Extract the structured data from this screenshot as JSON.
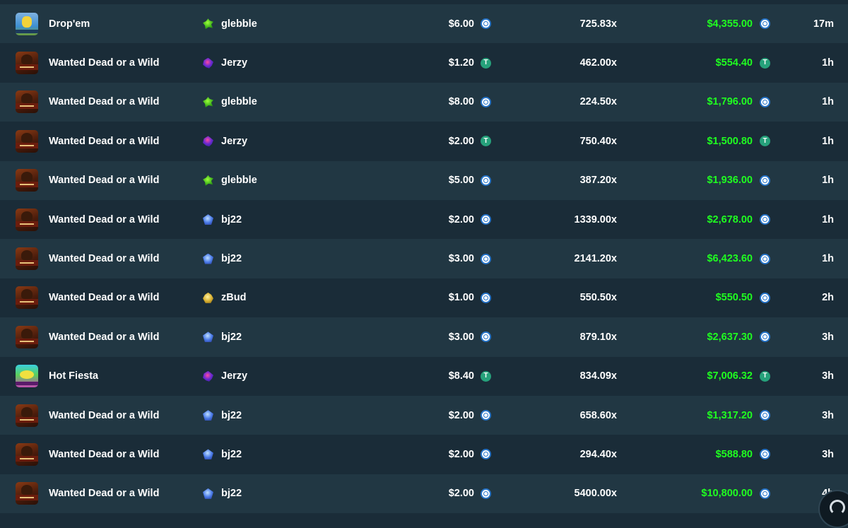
{
  "rows": [
    {
      "game": "Drop'em",
      "thumb": "dropem",
      "user": "glebble",
      "user_icon": "green",
      "bet": "$6.00",
      "bet_coin": "usdc",
      "multiplier": "725.83x",
      "payout": "$4,355.00",
      "payout_coin": "usdc",
      "time": "17m"
    },
    {
      "game": "Wanted Dead or a Wild",
      "thumb": "wanted",
      "user": "Jerzy",
      "user_icon": "purple",
      "bet": "$1.20",
      "bet_coin": "usdt",
      "multiplier": "462.00x",
      "payout": "$554.40",
      "payout_coin": "usdt",
      "time": "1h"
    },
    {
      "game": "Wanted Dead or a Wild",
      "thumb": "wanted",
      "user": "glebble",
      "user_icon": "green",
      "bet": "$8.00",
      "bet_coin": "usdc",
      "multiplier": "224.50x",
      "payout": "$1,796.00",
      "payout_coin": "usdc",
      "time": "1h"
    },
    {
      "game": "Wanted Dead or a Wild",
      "thumb": "wanted",
      "user": "Jerzy",
      "user_icon": "purple",
      "bet": "$2.00",
      "bet_coin": "usdt",
      "multiplier": "750.40x",
      "payout": "$1,500.80",
      "payout_coin": "usdt",
      "time": "1h"
    },
    {
      "game": "Wanted Dead or a Wild",
      "thumb": "wanted",
      "user": "glebble",
      "user_icon": "green",
      "bet": "$5.00",
      "bet_coin": "usdc",
      "multiplier": "387.20x",
      "payout": "$1,936.00",
      "payout_coin": "usdc",
      "time": "1h"
    },
    {
      "game": "Wanted Dead or a Wild",
      "thumb": "wanted",
      "user": "bj22",
      "user_icon": "blue",
      "bet": "$2.00",
      "bet_coin": "usdc",
      "multiplier": "1339.00x",
      "payout": "$2,678.00",
      "payout_coin": "usdc",
      "time": "1h"
    },
    {
      "game": "Wanted Dead or a Wild",
      "thumb": "wanted",
      "user": "bj22",
      "user_icon": "blue",
      "bet": "$3.00",
      "bet_coin": "usdc",
      "multiplier": "2141.20x",
      "payout": "$6,423.60",
      "payout_coin": "usdc",
      "time": "1h"
    },
    {
      "game": "Wanted Dead or a Wild",
      "thumb": "wanted",
      "user": "zBud",
      "user_icon": "gold",
      "bet": "$1.00",
      "bet_coin": "usdc",
      "multiplier": "550.50x",
      "payout": "$550.50",
      "payout_coin": "usdc",
      "time": "2h"
    },
    {
      "game": "Wanted Dead or a Wild",
      "thumb": "wanted",
      "user": "bj22",
      "user_icon": "blue",
      "bet": "$3.00",
      "bet_coin": "usdc",
      "multiplier": "879.10x",
      "payout": "$2,637.30",
      "payout_coin": "usdc",
      "time": "3h"
    },
    {
      "game": "Hot Fiesta",
      "thumb": "fiesta",
      "user": "Jerzy",
      "user_icon": "purple",
      "bet": "$8.40",
      "bet_coin": "usdt",
      "multiplier": "834.09x",
      "payout": "$7,006.32",
      "payout_coin": "usdt",
      "time": "3h"
    },
    {
      "game": "Wanted Dead or a Wild",
      "thumb": "wanted",
      "user": "bj22",
      "user_icon": "blue",
      "bet": "$2.00",
      "bet_coin": "usdc",
      "multiplier": "658.60x",
      "payout": "$1,317.20",
      "payout_coin": "usdc",
      "time": "3h"
    },
    {
      "game": "Wanted Dead or a Wild",
      "thumb": "wanted",
      "user": "bj22",
      "user_icon": "blue",
      "bet": "$2.00",
      "bet_coin": "usdc",
      "multiplier": "294.40x",
      "payout": "$588.80",
      "payout_coin": "usdc",
      "time": "3h"
    },
    {
      "game": "Wanted Dead or a Wild",
      "thumb": "wanted",
      "user": "bj22",
      "user_icon": "blue",
      "bet": "$2.00",
      "bet_coin": "usdc",
      "multiplier": "5400.00x",
      "payout": "$10,800.00",
      "payout_coin": "usdc",
      "time": "4h"
    }
  ],
  "colors": {
    "background": "#1a2c38",
    "row_alt": "#213743",
    "payout_green": "#1fff20",
    "usdc_blue": "#2775ca",
    "usdt_green": "#26a17b"
  },
  "icons": {
    "usdc": "usdc-coin-icon",
    "usdt": "usdt-coin-icon",
    "corner": "chat-support-icon"
  },
  "coin_glyph": {
    "usdt": "T",
    "usdc": ""
  }
}
